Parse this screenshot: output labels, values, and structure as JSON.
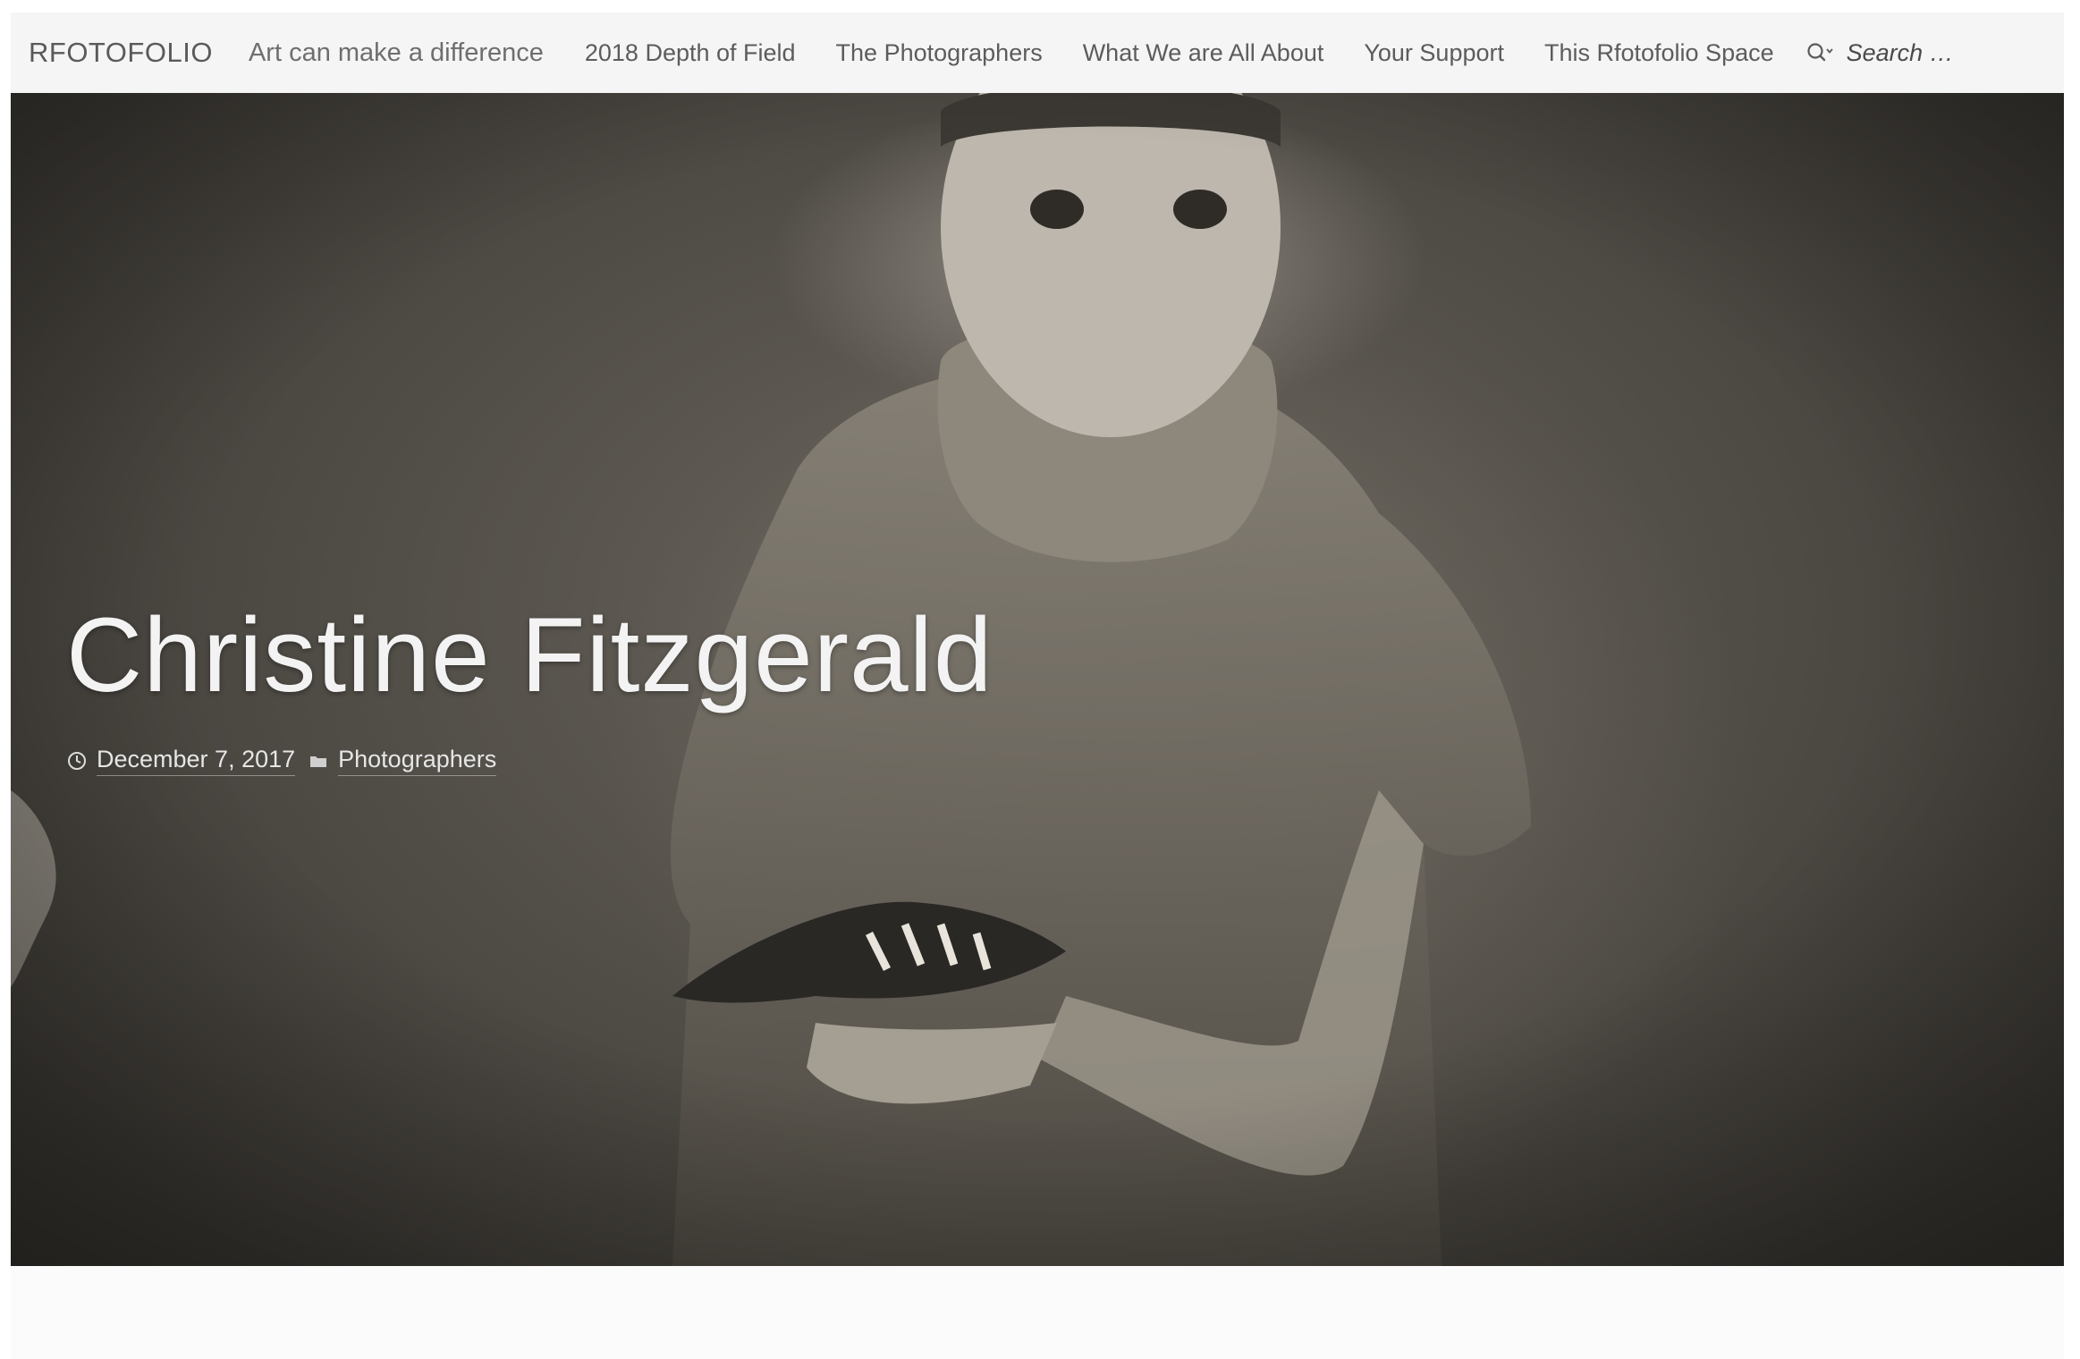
{
  "header": {
    "brand": "RFOTOFOLIO",
    "tagline": "Art can make a difference",
    "nav": [
      {
        "label": "2018 Depth of Field"
      },
      {
        "label": "The Photographers"
      },
      {
        "label": "What We are All About"
      },
      {
        "label": "Your Support"
      },
      {
        "label": "This Rfotofolio Space"
      }
    ],
    "search": {
      "placeholder": "Search …",
      "icon": "search-icon"
    }
  },
  "post": {
    "title": "Christine Fitzgerald",
    "date": "December 7, 2017",
    "category": "Photographers",
    "date_icon": "clock-icon",
    "category_icon": "folder-icon"
  },
  "colors": {
    "header_bg": "#f5f5f5",
    "nav_text": "#5c5c5c",
    "title_text": "#f3f3f3"
  }
}
